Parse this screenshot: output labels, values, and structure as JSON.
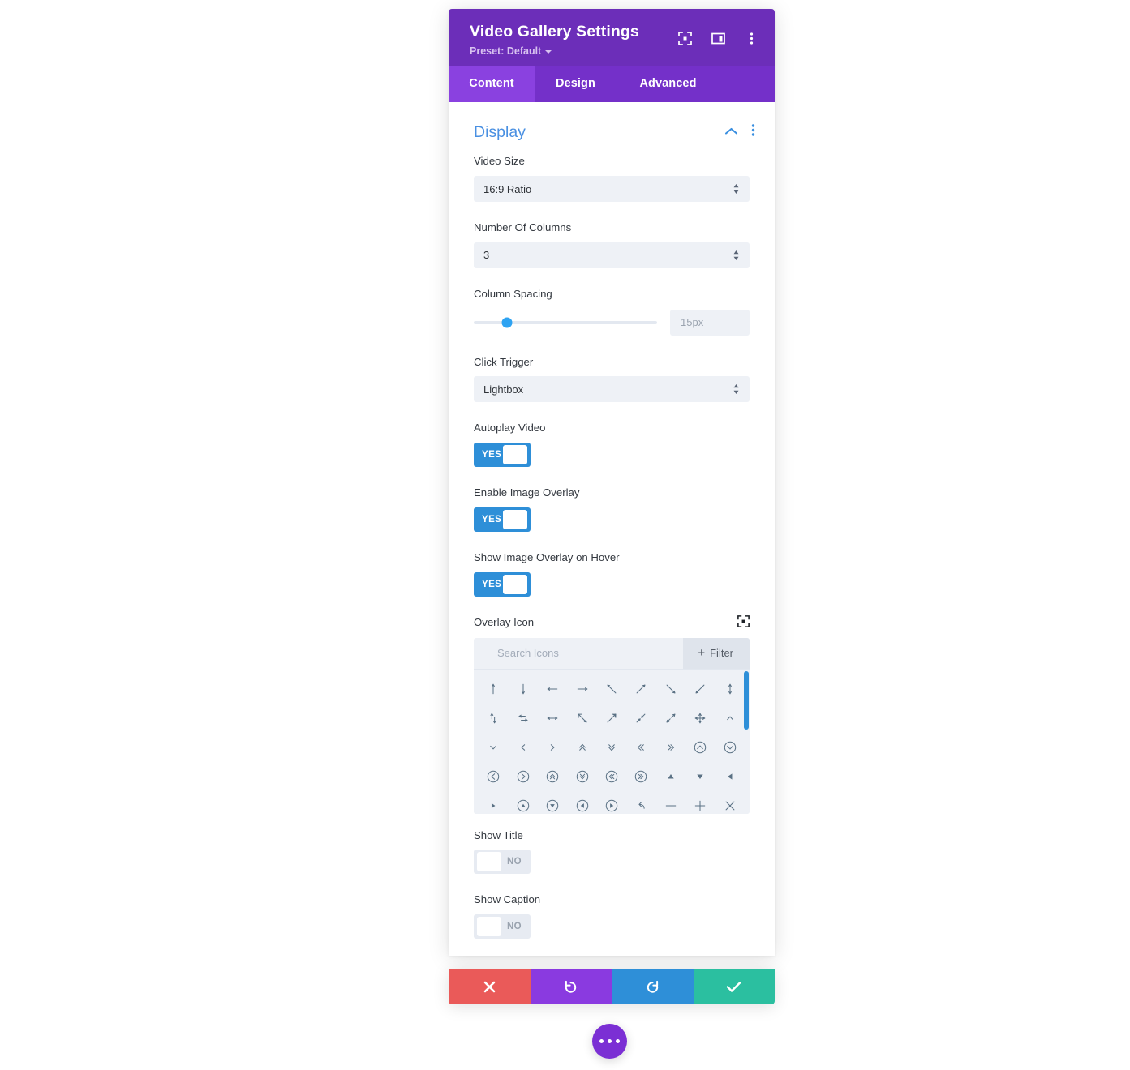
{
  "window": {
    "title": "Video Gallery Settings",
    "preset_label": "Preset: Default",
    "icons": {
      "focus": "focus-target-icon",
      "layout": "layout-columns-icon",
      "menu": "more-vertical-icon"
    }
  },
  "tabs": [
    {
      "label": "Content",
      "active": true
    },
    {
      "label": "Design",
      "active": false
    },
    {
      "label": "Advanced",
      "active": false
    }
  ],
  "section": {
    "title": "Display",
    "collapse_icon": "chevron-up-icon",
    "menu_icon": "more-vertical-icon"
  },
  "fields": {
    "video_size": {
      "label": "Video Size",
      "value": "16:9 Ratio"
    },
    "number_of_columns": {
      "label": "Number Of Columns",
      "value": "3"
    },
    "column_spacing": {
      "label": "Column Spacing",
      "value": "15px",
      "slider_percent": 18
    },
    "click_trigger": {
      "label": "Click Trigger",
      "value": "Lightbox"
    },
    "autoplay_video": {
      "label": "Autoplay Video",
      "state": "YES"
    },
    "enable_image_overlay": {
      "label": "Enable Image Overlay",
      "state": "YES"
    },
    "show_image_overlay_on_hover": {
      "label": "Show Image Overlay on Hover",
      "state": "YES"
    },
    "overlay_icon": {
      "label": "Overlay Icon",
      "responsive_icon": "focus-target-icon",
      "search_placeholder": "Search Icons",
      "filter_label": "Filter"
    },
    "show_title": {
      "label": "Show Title",
      "state": "NO"
    },
    "show_caption": {
      "label": "Show Caption",
      "state": "NO"
    }
  },
  "icon_grid": [
    "arrow-up",
    "arrow-down",
    "arrow-left",
    "arrow-right",
    "arrow-up-left",
    "arrow-up-right",
    "arrow-down-right",
    "arrow-down-left",
    "arrows-vertical",
    "arrows-up-down",
    "arrows-exchange",
    "arrows-horizontal",
    "arrow-expand-nw-se",
    "arrow-expand-sw-ne",
    "arrows-contract",
    "arrows-expand",
    "arrows-move",
    "chevron-up",
    "chevron-down",
    "chevron-left",
    "chevron-right",
    "chevrons-up",
    "chevrons-down",
    "chevrons-left",
    "chevrons-right",
    "circle-chevron-up",
    "circle-chevron-down",
    "circle-chevron-left",
    "circle-chevron-right",
    "circle-chevrons-up",
    "circle-chevrons-down",
    "circle-chevrons-left",
    "circle-chevrons-right",
    "triangle-up",
    "triangle-down",
    "triangle-left",
    "triangle-right",
    "circle-triangle-up",
    "circle-triangle-down",
    "circle-triangle-left",
    "circle-triangle-right",
    "undo-arrow",
    "minus",
    "plus",
    "close-x"
  ],
  "actions": [
    {
      "name": "cancel",
      "icon": "close-x-icon",
      "color": "#ea5a59"
    },
    {
      "name": "undo",
      "icon": "undo-icon",
      "color": "#8a3ae0"
    },
    {
      "name": "redo",
      "icon": "redo-icon",
      "color": "#2e8fd8"
    },
    {
      "name": "save",
      "icon": "check-icon",
      "color": "#2bbfa0"
    }
  ],
  "floating_button": {
    "icon": "more-horizontal-icon"
  },
  "colors": {
    "title_bar": "#6c2eb9",
    "tab_bar": "#7430c9",
    "tab_active": "#8a41e0",
    "section_title": "#4a90e2",
    "toggle_on": "#2e8fd8",
    "slider_handle": "#2ea3f2",
    "field_bg": "#eef1f6"
  }
}
